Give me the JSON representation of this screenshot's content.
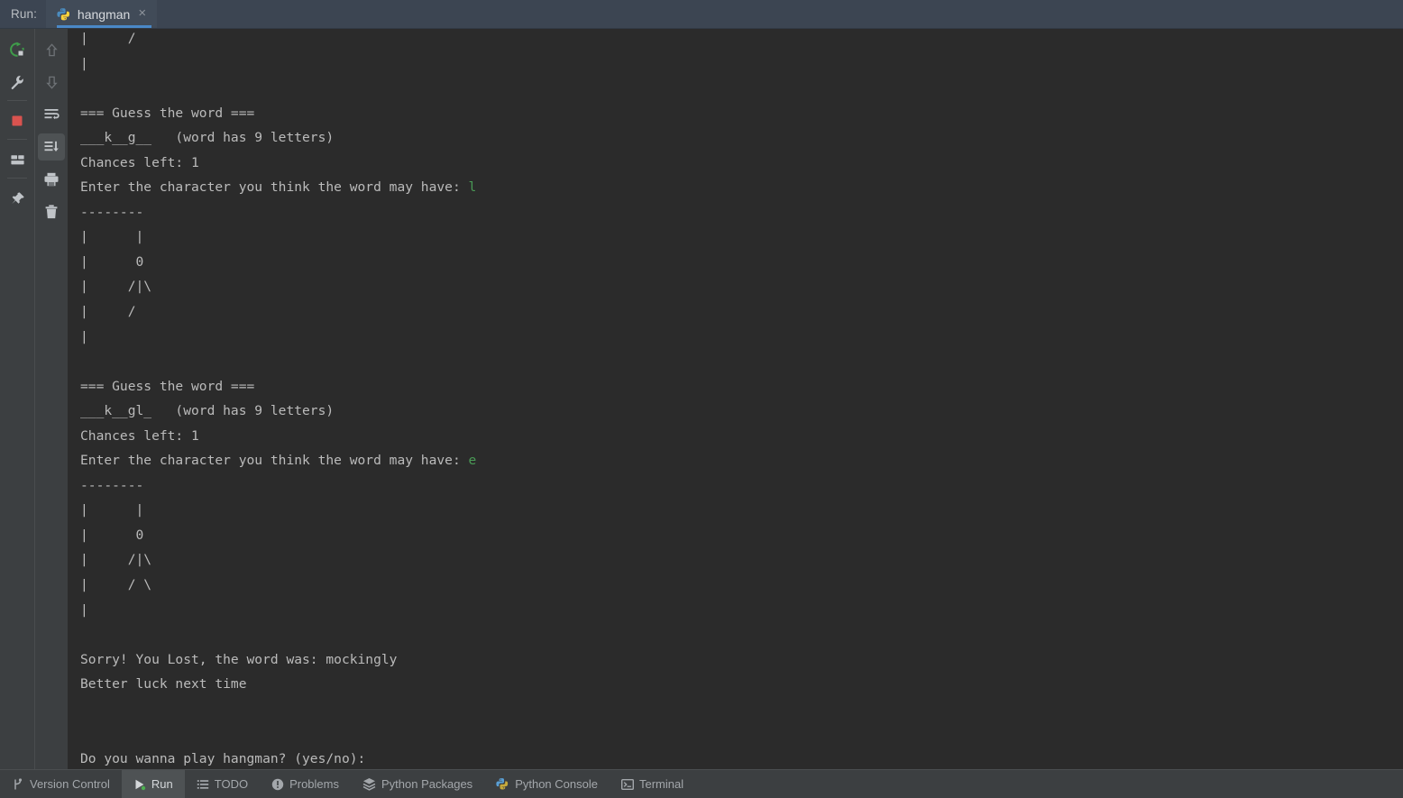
{
  "window": {
    "background_color": "#2b2b2b",
    "toolbar_color": "#3c3f41",
    "topbar_color": "#3c4552",
    "accent_color": "#4a88c7",
    "input_text_color": "#4a9b56"
  },
  "topbar": {
    "run_label": "Run:",
    "tab": {
      "title": "hangman",
      "icon": "python-icon",
      "close_label": "×",
      "active": true
    }
  },
  "left_toolbar": {
    "column_one": [
      {
        "name": "rerun-button",
        "label": "Rerun",
        "icon": "rerun-icon",
        "color": "#3f9c4a"
      },
      {
        "name": "edit-configurations-button",
        "label": "Modify Run Configuration",
        "icon": "wrench-icon",
        "color": "#b9bdc2"
      },
      {
        "name": "stop-button",
        "label": "Stop",
        "icon": "stop-square-icon",
        "color": "#d9534f"
      },
      {
        "name": "layout-settings-button",
        "label": "Layout Settings",
        "icon": "layout-icon",
        "color": "#b9bdc2"
      },
      {
        "name": "pin-tab-button",
        "label": "Pin Tab",
        "icon": "pin-icon",
        "color": "#b9bdc2"
      }
    ],
    "column_two": [
      {
        "name": "prev-occurrence-button",
        "label": "Previous Occurrence",
        "icon": "arrow-up-icon",
        "color": "#6e7276"
      },
      {
        "name": "next-occurrence-button",
        "label": "Next Occurrence",
        "icon": "arrow-down-icon",
        "color": "#6e7276"
      },
      {
        "name": "soft-wrap-button",
        "label": "Soft-Wrap",
        "icon": "soft-wrap-icon",
        "color": "#b9bdc2"
      },
      {
        "name": "scroll-to-end-button",
        "label": "Scroll to End",
        "icon": "scroll-to-end-icon",
        "color": "#b9bdc2",
        "selected": true
      },
      {
        "name": "print-button",
        "label": "Print",
        "icon": "printer-icon",
        "color": "#b9bdc2"
      },
      {
        "name": "clear-all-button",
        "label": "Clear All",
        "icon": "trash-icon",
        "color": "#b9bdc2"
      }
    ]
  },
  "console": {
    "name": "run-console-output",
    "lines_before_input_1": "|     /\n|\n\n=== Guess the word ===\n___k__g__   (word has 9 letters)\nChances left: 1\nEnter the character you think the word may have: ",
    "user_input_1": "l",
    "lines_between": "\n--------\n|      |\n|      0\n|     /|\\\n|     /\n|\n\n=== Guess the word ===\n___k__gl_   (word has 9 letters)\nChances left: 1\nEnter the character you think the word may have: ",
    "user_input_2": "e",
    "lines_after": "\n--------\n|      |\n|      0\n|     /|\\\n|     / \\\n|\n\nSorry! You Lost, the word was: mockingly\nBetter luck next time\n\n\nDo you wanna play hangman? (yes/no):",
    "game": {
      "header": "=== Guess the word ===",
      "word_state_1": "___k__g__",
      "word_state_2": "___k__gl_",
      "word_length_hint": "(word has 9 letters)",
      "chances_left_label": "Chances left:",
      "chances_left_value": "1",
      "prompt": "Enter the character you think the word may have:",
      "lost_message": "Sorry! You Lost, the word was: mockingly",
      "secret_word": "mockingly",
      "better_luck": "Better luck next time",
      "replay_prompt": "Do you wanna play hangman? (yes/no):"
    }
  },
  "statusbar": {
    "items": [
      {
        "name": "status-version-control",
        "label": "Version Control",
        "icon": "branch-icon",
        "active": false
      },
      {
        "name": "status-run",
        "label": "Run",
        "icon": "run-play-icon",
        "active": true
      },
      {
        "name": "status-todo",
        "label": "TODO",
        "icon": "list-icon",
        "active": false
      },
      {
        "name": "status-problems",
        "label": "Problems",
        "icon": "warning-circle-icon",
        "active": false
      },
      {
        "name": "status-python-packages",
        "label": "Python Packages",
        "icon": "layers-icon",
        "active": false
      },
      {
        "name": "status-python-console",
        "label": "Python Console",
        "icon": "python-icon",
        "active": false
      },
      {
        "name": "status-terminal",
        "label": "Terminal",
        "icon": "terminal-icon",
        "active": false
      }
    ]
  }
}
